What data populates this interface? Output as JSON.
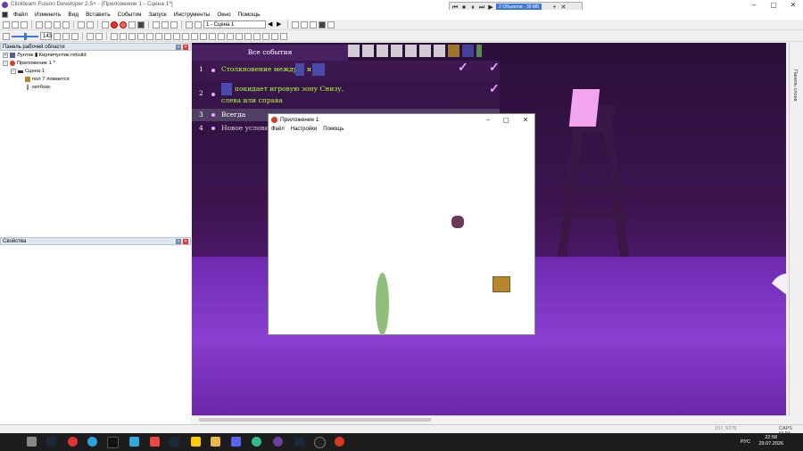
{
  "window": {
    "title": "Clickteam Fusion Developer 2.5+ - [Приложение 1 - Сцена 1*]",
    "minimize": "–",
    "maximize": "▢",
    "close": "✕"
  },
  "player_bar": {
    "counter": "2 Объектов - 39 МБ",
    "plus": "+",
    "close": "✕"
  },
  "menu": [
    "Файл",
    "Изменить",
    "Вид",
    "Вставить",
    "События",
    "Запуск",
    "Инструменты",
    "Окно",
    "Помощь"
  ],
  "toolbar": {
    "scene_combo": "1 - Сцена 1",
    "zoom_value": "143"
  },
  "workspace_panel": {
    "title": "Панель рабочей области",
    "tree": [
      {
        "label": "Лунтик ▮ Кирпичунтик rebuild"
      },
      {
        "label": "Приложение 1 *"
      },
      {
        "label": "Сцена 1"
      },
      {
        "label": "пол 7 ломается"
      },
      {
        "label": "хитбокс"
      }
    ]
  },
  "properties_panel": {
    "title": "Свойства"
  },
  "events_editor": {
    "header": "Все события",
    "rows": [
      {
        "num": "1",
        "text_a": "Столкновение между",
        "text_b": "и"
      },
      {
        "num": "2",
        "text_a": "покидает игровую зону Снизу,",
        "text_b": "слева или справа"
      },
      {
        "num": "3",
        "text_a": "Всегда"
      },
      {
        "num": "4",
        "text_a": "Новое услови"
      }
    ],
    "check_color": "#f0a0ff",
    "text_color": "#b4ff3a"
  },
  "app_window": {
    "title": "Приложение 1",
    "menu": [
      "Файл",
      "Настройки",
      "Помощь"
    ]
  },
  "right_sidebar": {
    "label": "Панель слоев"
  },
  "status": {
    "coords": "157, 6276",
    "caps": "CAPS NUM"
  },
  "taskbar": {
    "lang": "РУС",
    "time": "22:58",
    "date": "29.07.2026"
  }
}
